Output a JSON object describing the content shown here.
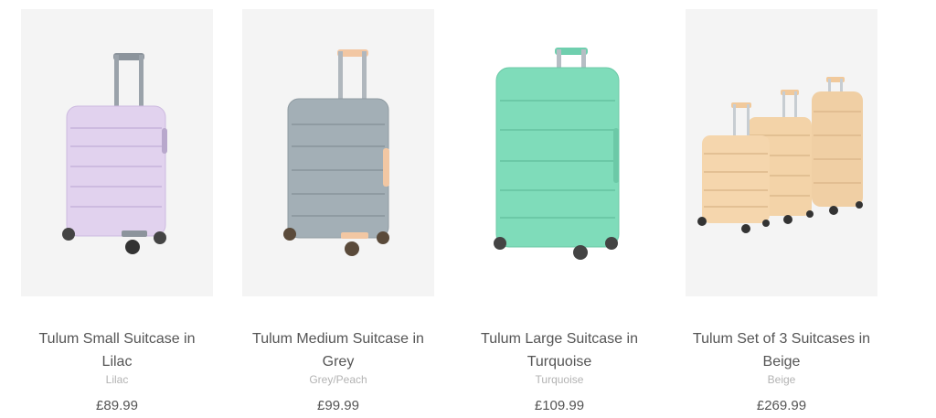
{
  "products": [
    {
      "title": "Tulum Small Suitcase in Lilac",
      "color": "Lilac",
      "price": "£89.99",
      "swatch": "#e1d2ee",
      "handle": "#8c949c"
    },
    {
      "title": "Tulum Medium Suitcase in Grey",
      "color": "Grey/Peach",
      "price": "£99.99",
      "swatch": "#a3afb6",
      "handle": "#f2c7a3"
    },
    {
      "title": "Tulum Large Suitcase in Turquoise",
      "color": "Turquoise",
      "price": "£109.99",
      "swatch": "#7fdcba",
      "handle": "#6fcfae"
    },
    {
      "title": "Tulum Set of 3 Suitcases in Beige",
      "color": "Beige",
      "price": "£269.99",
      "swatch": "#f0cfa4",
      "handle": "#f1c99b"
    }
  ]
}
